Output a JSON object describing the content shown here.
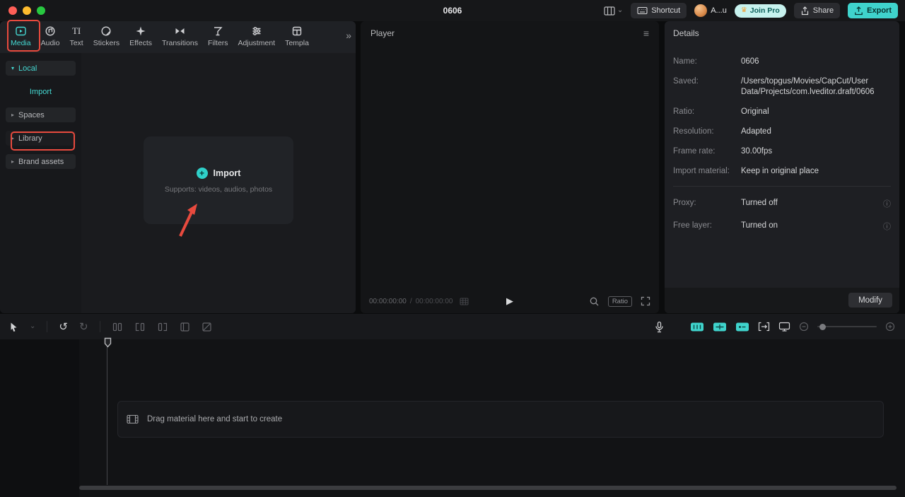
{
  "titlebar": {
    "title": "0606",
    "shortcut": "Shortcut",
    "account": "A...u",
    "join_pro": "Join Pro",
    "share": "Share",
    "export": "Export"
  },
  "tabs": [
    {
      "label": "Media"
    },
    {
      "label": "Audio"
    },
    {
      "label": "Text"
    },
    {
      "label": "Stickers"
    },
    {
      "label": "Effects"
    },
    {
      "label": "Transitions"
    },
    {
      "label": "Filters"
    },
    {
      "label": "Adjustment"
    },
    {
      "label": "Templa"
    }
  ],
  "sidebar": {
    "local": "Local",
    "import": "Import",
    "spaces": "Spaces",
    "library": "Library",
    "brand_assets": "Brand assets"
  },
  "media": {
    "import_title": "Import",
    "import_hint": "Supports: videos, audios, photos"
  },
  "player": {
    "title": "Player",
    "current_time": "00:00:00:00",
    "separator": "/",
    "total_time": "00:00:00:00",
    "ratio": "Ratio"
  },
  "details": {
    "title": "Details",
    "rows": [
      {
        "label": "Name:",
        "value": "0606"
      },
      {
        "label": "Saved:",
        "value": "/Users/topgus/Movies/CapCut/User Data/Projects/com.lveditor.draft/0606"
      },
      {
        "label": "Ratio:",
        "value": "Original"
      },
      {
        "label": "Resolution:",
        "value": "Adapted"
      },
      {
        "label": "Frame rate:",
        "value": "30.00fps"
      },
      {
        "label": "Import material:",
        "value": "Keep in original place"
      }
    ],
    "proxy_label": "Proxy:",
    "proxy_value": "Turned off",
    "free_layer_label": "Free layer:",
    "free_layer_value": "Turned on",
    "modify": "Modify"
  },
  "timeline": {
    "empty_hint": "Drag material here and start to create"
  },
  "icons": {
    "undo": "↺",
    "redo": "↻",
    "hamburger": "≡",
    "play": "▶",
    "caret_down": "⌄",
    "triangle_down": "▾",
    "triangle_right": "▸",
    "double_chevron": "»",
    "crown": "♛",
    "info": "ⓘ",
    "plus": "+",
    "text_tab": "TI"
  },
  "colors": {
    "accent": "#3fd3cc",
    "annotation": "#e84a3e"
  }
}
